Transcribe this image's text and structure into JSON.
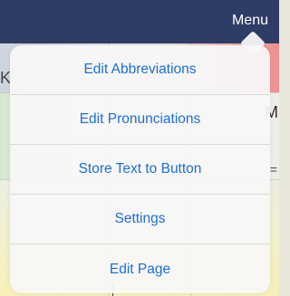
{
  "navbar": {
    "menu_label": "Menu"
  },
  "background": {
    "left_letter": "K",
    "right_letter": "M",
    "eq_glyph": "="
  },
  "menu": {
    "items": [
      {
        "label": "Edit Abbreviations"
      },
      {
        "label": "Edit Pronunciations"
      },
      {
        "label": "Store Text to Button"
      },
      {
        "label": "Settings"
      },
      {
        "label": "Edit Page"
      }
    ]
  },
  "colors": {
    "navbar": "#2f3d66",
    "menu_text": "#1b6fd6",
    "popover_bg": "#f8f8f8"
  }
}
